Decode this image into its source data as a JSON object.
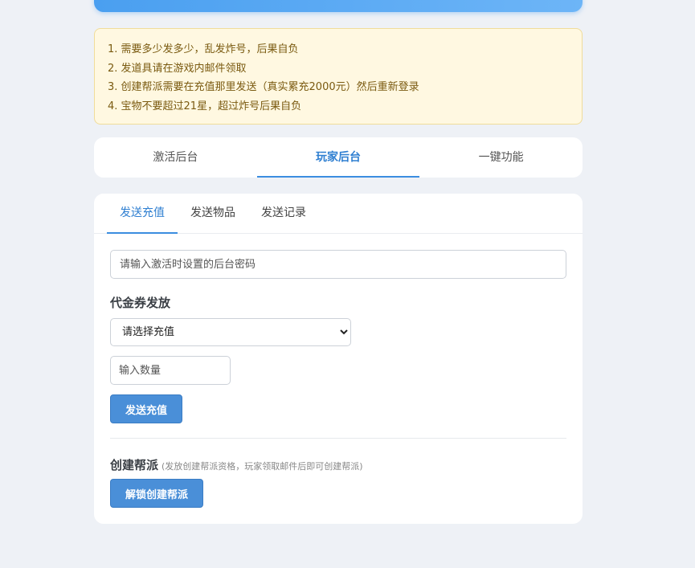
{
  "notice": {
    "lines": [
      "1. 需要多少发多少，乱发炸号，后果自负",
      "2. 发道具请在游戏内邮件领取",
      "3. 创建帮派需要在充值那里发送（真实累充2000元）然后重新登录",
      "4. 宝物不要超过21星，超过炸号后果自负"
    ]
  },
  "main_tabs": [
    {
      "label": "激活后台",
      "active": false
    },
    {
      "label": "玩家后台",
      "active": true
    },
    {
      "label": "一键功能",
      "active": false
    }
  ],
  "sub_tabs": [
    {
      "label": "发送充值",
      "active": true
    },
    {
      "label": "发送物品",
      "active": false
    },
    {
      "label": "发送记录",
      "active": false
    }
  ],
  "password_input": {
    "placeholder": "请输入激活时设置的后台密码",
    "value": ""
  },
  "voucher": {
    "title": "代金券发放",
    "select_value": "请选择充值",
    "quantity_placeholder": "输入数量",
    "send_button": "发送充值"
  },
  "guild": {
    "title": "创建帮派",
    "hint": "(发放创建帮派资格，玩家领取邮件后即可创建帮派)",
    "unlock_button": "解锁创建帮派"
  },
  "colors": {
    "accent": "#3b8de0",
    "button": "#4a8fd8",
    "notice_bg": "#fff8e1",
    "page_bg": "#eef1f6"
  }
}
